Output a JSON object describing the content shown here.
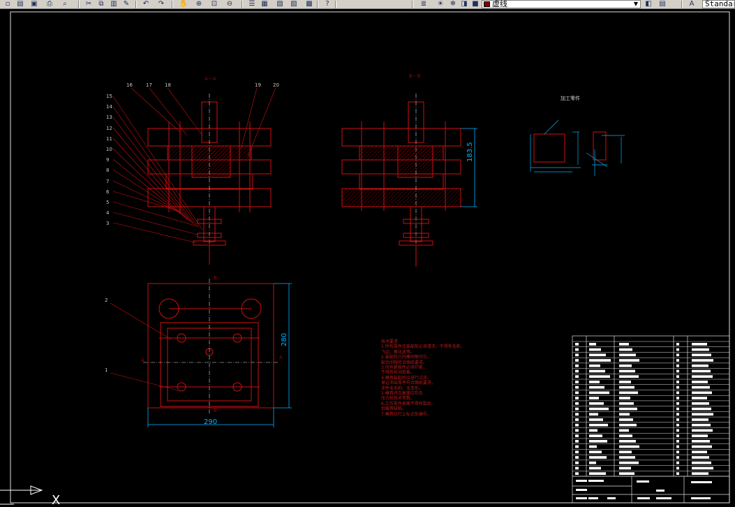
{
  "toolbar": {
    "layer_name": "虚线",
    "text_style": "Standard",
    "buttons": [
      "new-icon",
      "open-icon",
      "save-icon",
      "print-icon",
      "plot-preview-icon",
      "cut-icon",
      "copy-icon",
      "paste-icon",
      "match-properties-icon",
      "undo-icon",
      "redo-icon",
      "pan-icon",
      "zoom-realtime-icon",
      "zoom-window-icon",
      "zoom-previous-icon",
      "properties-icon",
      "design-center-icon",
      "tool-palette-icon",
      "sheet-set-icon",
      "calculator-icon",
      "help-icon",
      "layer-manager-icon",
      "layer-on-icon",
      "layer-freeze-icon",
      "layer-lock-icon",
      "layer-color-icon",
      "layer-previous-icon",
      "layer-state-icon",
      "text-style-icon"
    ]
  },
  "drawing": {
    "section_a_title": "A－A",
    "section_b_title": "B－B",
    "part_title": "加工零件",
    "part_numbers_left": [
      "15",
      "14",
      "13",
      "12",
      "11",
      "10",
      "9",
      "8",
      "7",
      "6",
      "5",
      "4",
      "3"
    ],
    "part_numbers_top": [
      "16",
      "17",
      "18",
      "19",
      "20"
    ],
    "plan_callouts": [
      "2",
      "1"
    ],
    "dim_height_b": "183.5",
    "dim_plan_height": "280",
    "dim_plan_width": "290",
    "plan_marks": [
      "B",
      "B",
      "A",
      "A"
    ],
    "axis_label": "X"
  },
  "tech_notes": {
    "title": "技术要求",
    "lines": [
      "1.所有零件在装配前必须清洗，不得有毛刺、",
      "  飞边、氧化皮等。",
      "2.装配后凸凹模间隙均匀，",
      "  配合间隙符合图纸要求。",
      "3.所有紧固件必须拧紧，",
      "  不得有松动现象。",
      "4.模具装配后应进行试冲，",
      "  保证冲出零件符合图纸要求，",
      "  冲件无毛刺、无变形。",
      "5.模具闭合高度应符合",
      "  压力机技术参数。",
      "6.工作零件表面不得有裂纹、",
      "  划痕等缺陷。",
      "7.模具应打上标记及编号。"
    ]
  },
  "title_block": {
    "row_count": 25,
    "bottom_labels": [
      "设计",
      "校核",
      "审核",
      "标准化",
      "日期",
      "比例",
      "图号"
    ]
  }
}
